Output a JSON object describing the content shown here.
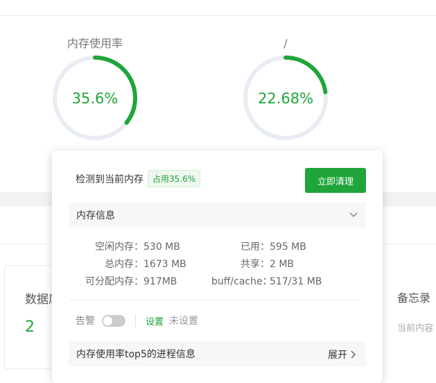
{
  "gauges": [
    {
      "title": "内存使用率",
      "value_text": "35.6%",
      "percent": 35.6
    },
    {
      "title": "/",
      "value_text": "22.68%",
      "percent": 22.68
    }
  ],
  "colors": {
    "accent": "#20a53a",
    "ring_track": "#e8ecf3"
  },
  "left_card": {
    "title": "数据库",
    "count": "2"
  },
  "right_card": {
    "title": "备忘录",
    "sub": "当前内容"
  },
  "popup": {
    "header_label": "检测到当前内存",
    "usage_badge": "占用35.6%",
    "clean_button": "立即清理",
    "info_section_label": "内存信息",
    "stats_left": [
      {
        "label": "空闲内存：",
        "value": "530 MB"
      },
      {
        "label": "总内存：",
        "value": "1673 MB"
      },
      {
        "label": "可分配内存：",
        "value": "917MB"
      }
    ],
    "stats_right": [
      {
        "label": "已用：",
        "value": "595 MB"
      },
      {
        "label": "共享：",
        "value": "2 MB"
      },
      {
        "label": "buff/cache：",
        "value": "517/31 MB"
      }
    ],
    "alarm_label": "告警",
    "alarm_setting_link": "设置",
    "alarm_status": "未设置",
    "process_section_label": "内存使用率top5的进程信息",
    "expand_label": "展开"
  }
}
